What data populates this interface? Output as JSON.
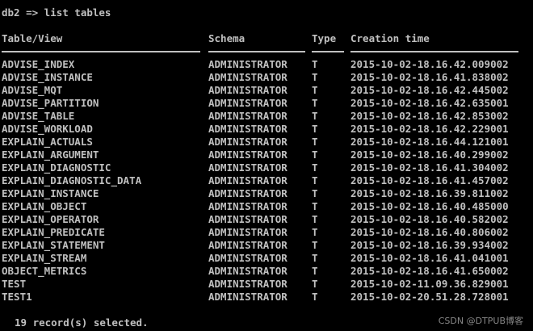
{
  "terminal": {
    "prompt": "db2 => list tables",
    "columns": {
      "name": "Table/View",
      "schema": "Schema",
      "type": "Type",
      "time": "Creation time"
    },
    "rows": [
      {
        "name": "ADVISE_INDEX",
        "schema": "ADMINISTRATOR",
        "type": "T",
        "time": "2015-10-02-18.16.42.009002"
      },
      {
        "name": "ADVISE_INSTANCE",
        "schema": "ADMINISTRATOR",
        "type": "T",
        "time": "2015-10-02-18.16.41.838002"
      },
      {
        "name": "ADVISE_MQT",
        "schema": "ADMINISTRATOR",
        "type": "T",
        "time": "2015-10-02-18.16.42.445002"
      },
      {
        "name": "ADVISE_PARTITION",
        "schema": "ADMINISTRATOR",
        "type": "T",
        "time": "2015-10-02-18.16.42.635001"
      },
      {
        "name": "ADVISE_TABLE",
        "schema": "ADMINISTRATOR",
        "type": "T",
        "time": "2015-10-02-18.16.42.853002"
      },
      {
        "name": "ADVISE_WORKLOAD",
        "schema": "ADMINISTRATOR",
        "type": "T",
        "time": "2015-10-02-18.16.42.229001"
      },
      {
        "name": "EXPLAIN_ACTUALS",
        "schema": "ADMINISTRATOR",
        "type": "T",
        "time": "2015-10-02-18.16.44.121001"
      },
      {
        "name": "EXPLAIN_ARGUMENT",
        "schema": "ADMINISTRATOR",
        "type": "T",
        "time": "2015-10-02-18.16.40.299002"
      },
      {
        "name": "EXPLAIN_DIAGNOSTIC",
        "schema": "ADMINISTRATOR",
        "type": "T",
        "time": "2015-10-02-18.16.41.304002"
      },
      {
        "name": "EXPLAIN_DIAGNOSTIC_DATA",
        "schema": "ADMINISTRATOR",
        "type": "T",
        "time": "2015-10-02-18.16.41.457002"
      },
      {
        "name": "EXPLAIN_INSTANCE",
        "schema": "ADMINISTRATOR",
        "type": "T",
        "time": "2015-10-02-18.16.39.811002"
      },
      {
        "name": "EXPLAIN_OBJECT",
        "schema": "ADMINISTRATOR",
        "type": "T",
        "time": "2015-10-02-18.16.40.485000"
      },
      {
        "name": "EXPLAIN_OPERATOR",
        "schema": "ADMINISTRATOR",
        "type": "T",
        "time": "2015-10-02-18.16.40.582002"
      },
      {
        "name": "EXPLAIN_PREDICATE",
        "schema": "ADMINISTRATOR",
        "type": "T",
        "time": "2015-10-02-18.16.40.806002"
      },
      {
        "name": "EXPLAIN_STATEMENT",
        "schema": "ADMINISTRATOR",
        "type": "T",
        "time": "2015-10-02-18.16.39.934002"
      },
      {
        "name": "EXPLAIN_STREAM",
        "schema": "ADMINISTRATOR",
        "type": "T",
        "time": "2015-10-02-18.16.41.041001"
      },
      {
        "name": "OBJECT_METRICS",
        "schema": "ADMINISTRATOR",
        "type": "T",
        "time": "2015-10-02-18.16.41.650002"
      },
      {
        "name": "TEST",
        "schema": "ADMINISTRATOR",
        "type": "T",
        "time": "2015-10-02-11.09.36.829001"
      },
      {
        "name": "TEST1",
        "schema": "ADMINISTRATOR",
        "type": "T",
        "time": "2015-10-02-20.51.28.728001"
      }
    ],
    "footer": "19 record(s) selected.",
    "watermark": "CSDN @DTPUB博客"
  },
  "colors": {
    "background": "#000000",
    "text": "#c0c0c0"
  }
}
